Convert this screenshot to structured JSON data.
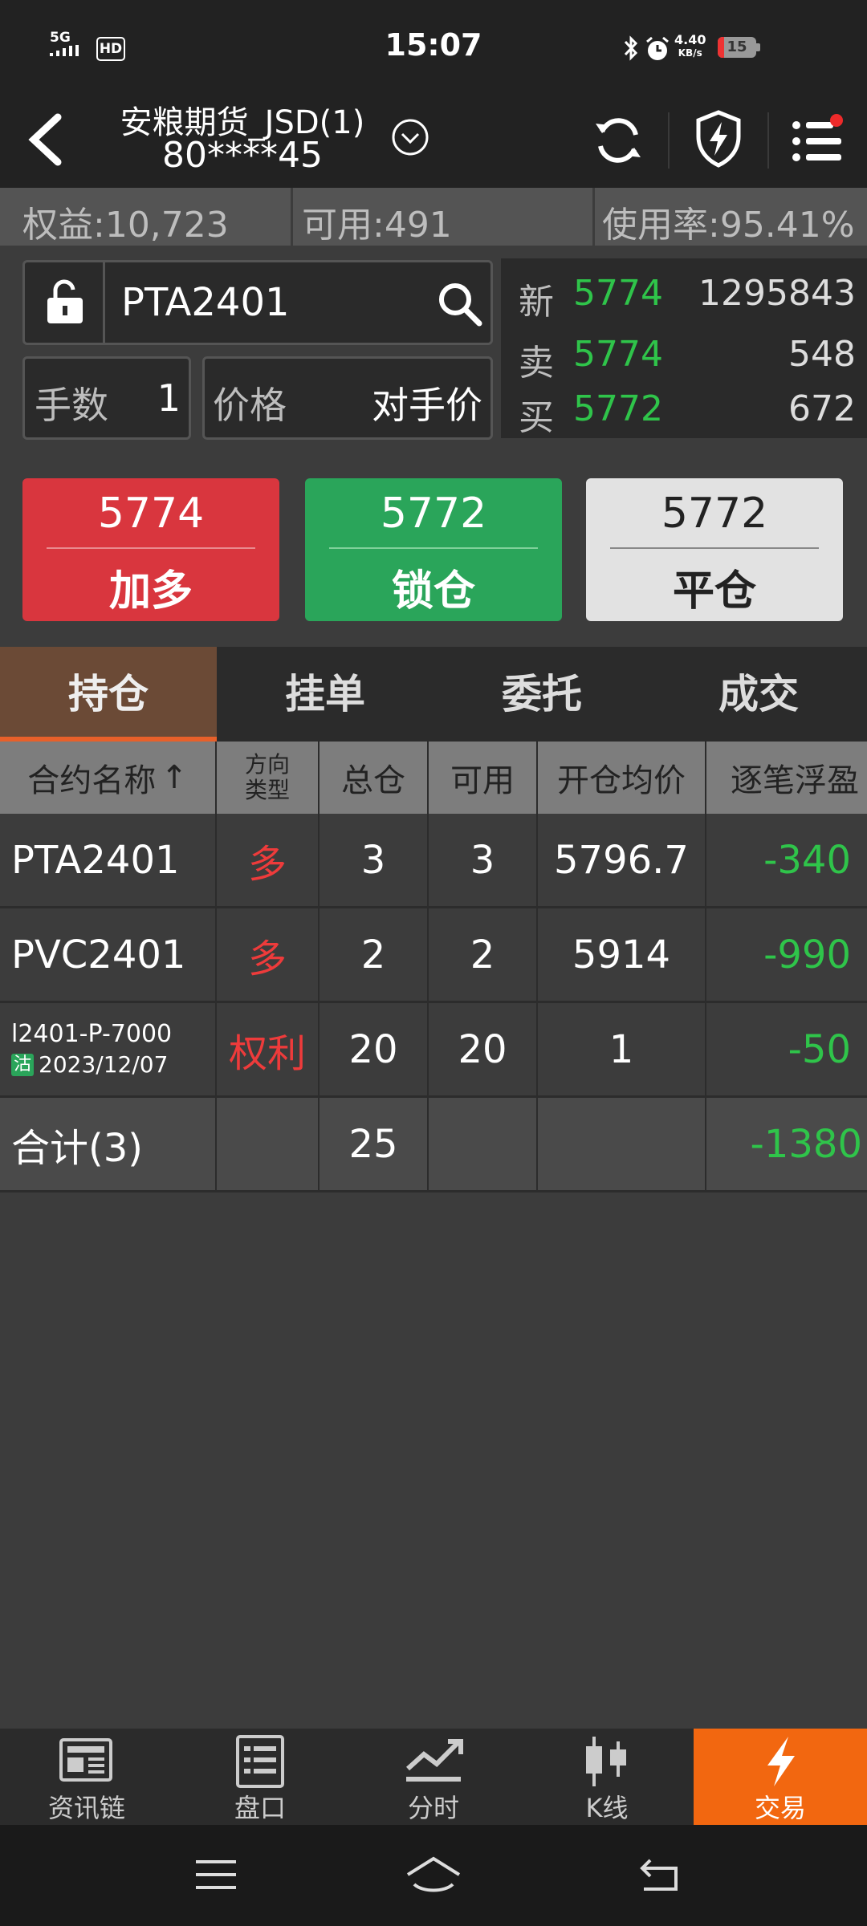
{
  "status_bar": {
    "network": "5G",
    "hd": "HD",
    "time": "15:07",
    "speed_value": "4.40",
    "speed_unit": "KB/s",
    "battery": "15"
  },
  "header": {
    "account_title": "安粮期货_JSD(1)",
    "account_number": "80****45"
  },
  "summary": {
    "equity": "权益:10,723",
    "available": "可用:491",
    "usage": "使用率:95.41%"
  },
  "order": {
    "contract": "PTA2401",
    "qty_label": "手数",
    "qty_value": "1",
    "price_label": "价格",
    "price_value": "对手价"
  },
  "quote": {
    "rows": [
      {
        "label": "新",
        "price": "5774",
        "volume": "1295843"
      },
      {
        "label": "卖",
        "price": "5774",
        "volume": "548"
      },
      {
        "label": "买",
        "price": "5772",
        "volume": "672"
      }
    ]
  },
  "actions": {
    "buy_price": "5774",
    "buy_label": "加多",
    "lock_price": "5772",
    "lock_label": "锁仓",
    "close_price": "5772",
    "close_label": "平仓"
  },
  "tabs": [
    "持仓",
    "挂单",
    "委托",
    "成交"
  ],
  "table": {
    "headers": {
      "name": "合约名称",
      "sort_arrow": "↑",
      "dir_line1": "方向",
      "dir_line2": "类型",
      "total": "总仓",
      "avail": "可用",
      "avg": "开仓均价",
      "float": "逐笔浮盈"
    },
    "rows": [
      {
        "name": "PTA2401",
        "dir": "多",
        "total": "3",
        "avail": "3",
        "avg": "5796.7",
        "pnl": "-340"
      },
      {
        "name": "PVC2401",
        "dir": "多",
        "total": "2",
        "avail": "2",
        "avg": "5914",
        "pnl": "-990"
      },
      {
        "name": "l2401-P-7000",
        "badge": "沽",
        "date": "2023/12/07",
        "dir": "权利",
        "total": "20",
        "avail": "20",
        "avg": "1",
        "pnl": "-50"
      }
    ],
    "total_row": {
      "name": "合计(3)",
      "total": "25",
      "pnl": "-1380"
    }
  },
  "nav": [
    {
      "label": "资讯链",
      "icon": "news-icon"
    },
    {
      "label": "盘口",
      "icon": "orderbook-icon"
    },
    {
      "label": "分时",
      "icon": "intraday-chart-icon"
    },
    {
      "label": "K线",
      "icon": "candlestick-icon"
    },
    {
      "label": "交易",
      "icon": "lightning-icon"
    }
  ],
  "colors": {
    "up_red": "#d9363e",
    "down_green": "#2fc44a",
    "accent_orange": "#f26710",
    "lock_green": "#2aa55a",
    "close_gray": "#e2e2e2"
  }
}
